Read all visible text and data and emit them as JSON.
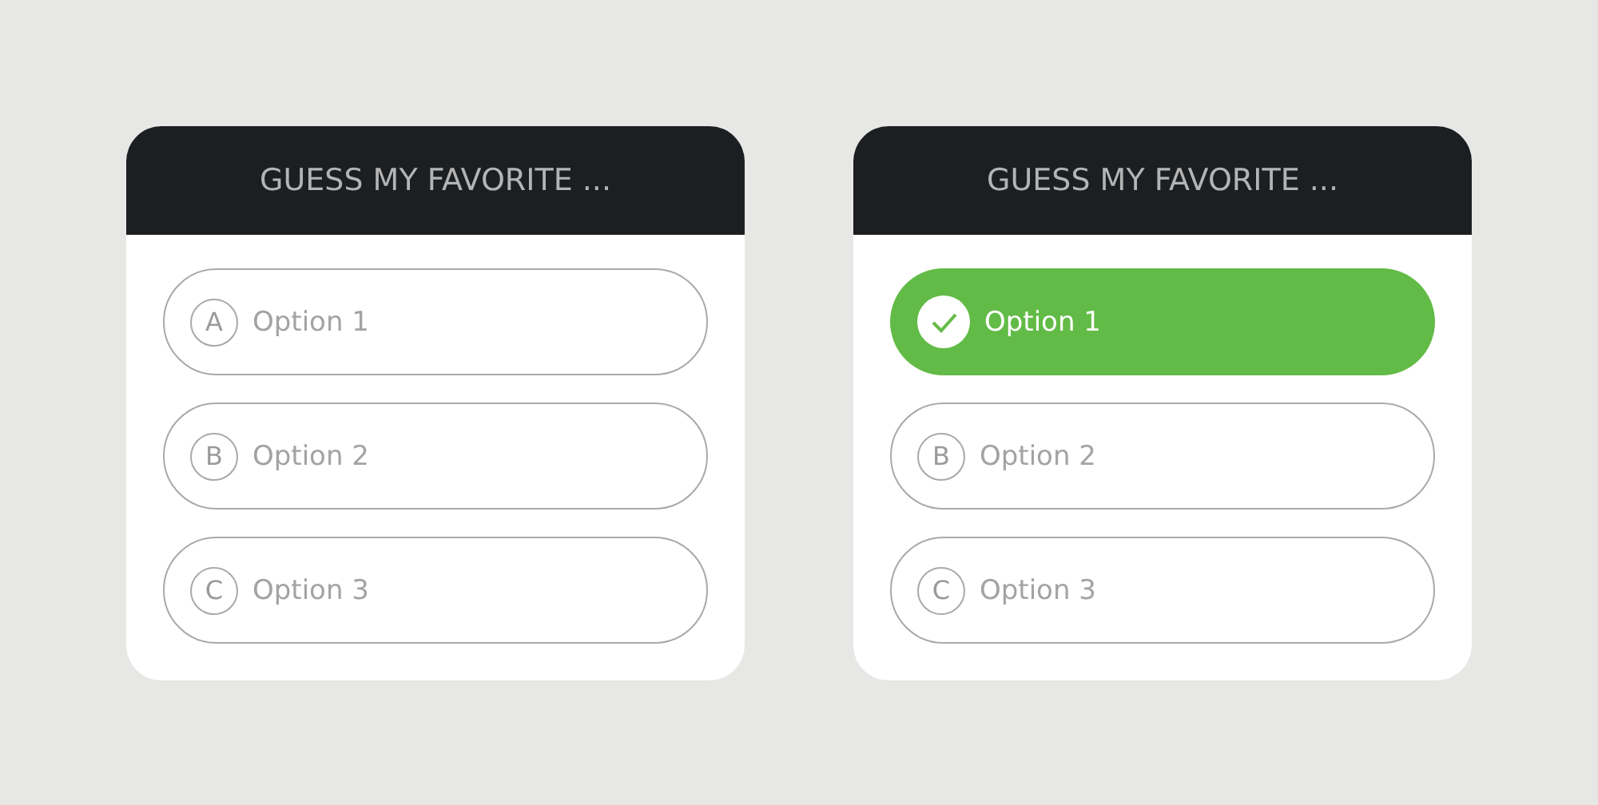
{
  "cards": [
    {
      "title": "GUESS MY FAVORITE ...",
      "options": [
        {
          "letter": "A",
          "label": "Option 1",
          "selected": false
        },
        {
          "letter": "B",
          "label": "Option 2",
          "selected": false
        },
        {
          "letter": "C",
          "label": "Option 3",
          "selected": false
        }
      ]
    },
    {
      "title": "GUESS MY FAVORITE ...",
      "options": [
        {
          "label": "Option 1",
          "selected": true
        },
        {
          "letter": "B",
          "label": "Option 2",
          "selected": false
        },
        {
          "letter": "C",
          "label": "Option 3",
          "selected": false
        }
      ]
    }
  ]
}
